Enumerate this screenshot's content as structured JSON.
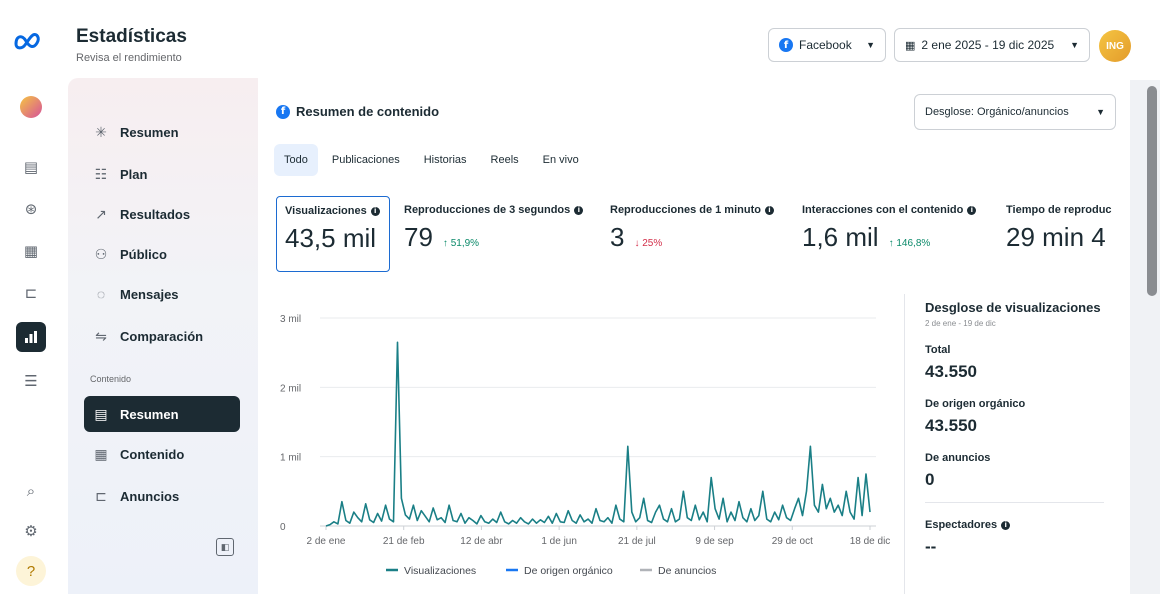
{
  "header": {
    "title": "Estadísticas",
    "subtitle": "Revisa el rendimiento",
    "platform": "Facebook",
    "date_range": "2 ene 2025 - 19 dic 2025",
    "avatar_text": "ING"
  },
  "sidebar": {
    "items": [
      {
        "label": "Resumen",
        "icon": "sparkle-icon"
      },
      {
        "label": "Plan",
        "icon": "list-icon"
      },
      {
        "label": "Resultados",
        "icon": "trend-icon"
      },
      {
        "label": "Público",
        "icon": "people-icon"
      },
      {
        "label": "Mensajes",
        "icon": "chat-icon"
      },
      {
        "label": "Comparación",
        "icon": "compare-icon"
      }
    ],
    "section_label": "Contenido",
    "content_items": [
      {
        "label": "Resumen",
        "icon": "stack-icon",
        "active": true
      },
      {
        "label": "Contenido",
        "icon": "grid-icon"
      },
      {
        "label": "Anuncios",
        "icon": "megaphone-icon"
      }
    ]
  },
  "main": {
    "card_title": "Resumen de contenido",
    "breakdown_label": "Desglose: Orgánico/anuncios",
    "tabs": [
      "Todo",
      "Publicaciones",
      "Historias",
      "Reels",
      "En vivo"
    ],
    "metrics": [
      {
        "label": "Visualizaciones",
        "value": "43,5 mil",
        "change": "",
        "direction": ""
      },
      {
        "label": "Reproducciones de 3 segundos",
        "value": "79",
        "change": "51,9%",
        "direction": "up"
      },
      {
        "label": "Reproducciones de 1 minuto",
        "value": "3",
        "change": "25%",
        "direction": "down"
      },
      {
        "label": "Interacciones con el contenido",
        "value": "1,6 mil",
        "change": "146,8%",
        "direction": "up"
      },
      {
        "label": "Tiempo de reproduc",
        "value": "29 min 4",
        "change": "",
        "direction": ""
      }
    ]
  },
  "panel": {
    "title": "Desglose de visualizaciones",
    "date": "2 de ene - 19 de dic",
    "total_label": "Total",
    "total_value": "43.550",
    "organic_label": "De origen orgánico",
    "organic_value": "43.550",
    "ads_label": "De anuncios",
    "ads_value": "0",
    "viewers_label": "Espectadores",
    "viewers_value": "--"
  },
  "chart_data": {
    "type": "line",
    "x_ticks": [
      "2 de ene",
      "21 de feb",
      "12 de abr",
      "1 de jun",
      "21 de jul",
      "9 de sep",
      "29 de oct",
      "18 de dic"
    ],
    "y_ticks": [
      "0",
      "1 mil",
      "2 mil",
      "3 mil"
    ],
    "ylim": [
      0,
      3000
    ],
    "series": [
      {
        "name": "Visualizaciones",
        "color": "#1a7f86",
        "values": [
          0,
          20,
          60,
          30,
          350,
          80,
          40,
          200,
          120,
          60,
          320,
          90,
          50,
          180,
          70,
          300,
          100,
          60,
          2650,
          400,
          160,
          100,
          300,
          80,
          220,
          140,
          60,
          260,
          90,
          120,
          50,
          300,
          80,
          60,
          180,
          40,
          120,
          80,
          30,
          150,
          60,
          40,
          100,
          50,
          200,
          60,
          30,
          80,
          40,
          120,
          60,
          30,
          100,
          40,
          90,
          50,
          140,
          40,
          180,
          60,
          50,
          220,
          80,
          40,
          160,
          60,
          100,
          40,
          250,
          80,
          60,
          120,
          40,
          300,
          100,
          60,
          1150,
          200,
          60,
          120,
          400,
          80,
          50,
          200,
          300,
          100,
          60,
          250,
          60,
          100,
          500,
          120,
          80,
          300,
          90,
          200,
          60,
          700,
          250,
          100,
          400,
          60,
          200,
          80,
          350,
          120,
          60,
          250,
          80,
          150,
          500,
          100,
          60,
          200,
          90,
          300,
          120,
          80,
          250,
          400,
          150,
          500,
          1150,
          300,
          200,
          600,
          250,
          400,
          200,
          300,
          150,
          500,
          200,
          100,
          700,
          150,
          750,
          200
        ]
      },
      {
        "name": "De origen orgánico",
        "color": "#1877f2",
        "values": []
      },
      {
        "name": "De anuncios",
        "color": "#b0b3b8",
        "values": []
      }
    ],
    "legend_position": "bottom"
  }
}
